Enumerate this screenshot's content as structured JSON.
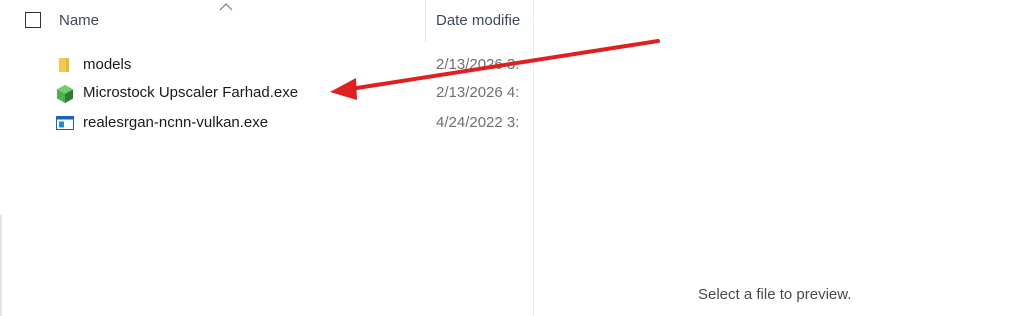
{
  "header": {
    "name_label": "Name",
    "date_label": "Date modifie",
    "sort_direction": "ascending"
  },
  "files": [
    {
      "name": "models",
      "date": "2/13/2026 3:",
      "icon": "folder-icon"
    },
    {
      "name": "Microstock Upscaler Farhad.exe",
      "date": "2/13/2026 4:",
      "icon": "hexagon-app-icon"
    },
    {
      "name": "realesrgan-ncnn-vulkan.exe",
      "date": "4/24/2022 3:",
      "icon": "window-app-icon"
    }
  ],
  "preview": {
    "message": "Select a file to preview."
  },
  "annotation": {
    "type": "arrow",
    "color": "#e02020",
    "points_to": "Microstock Upscaler Farhad.exe"
  },
  "colors": {
    "folder": "#f2c94c",
    "exe_icon": "#4caf50",
    "app_icon": "#1565c0",
    "annotation_arrow": "#e02020"
  }
}
